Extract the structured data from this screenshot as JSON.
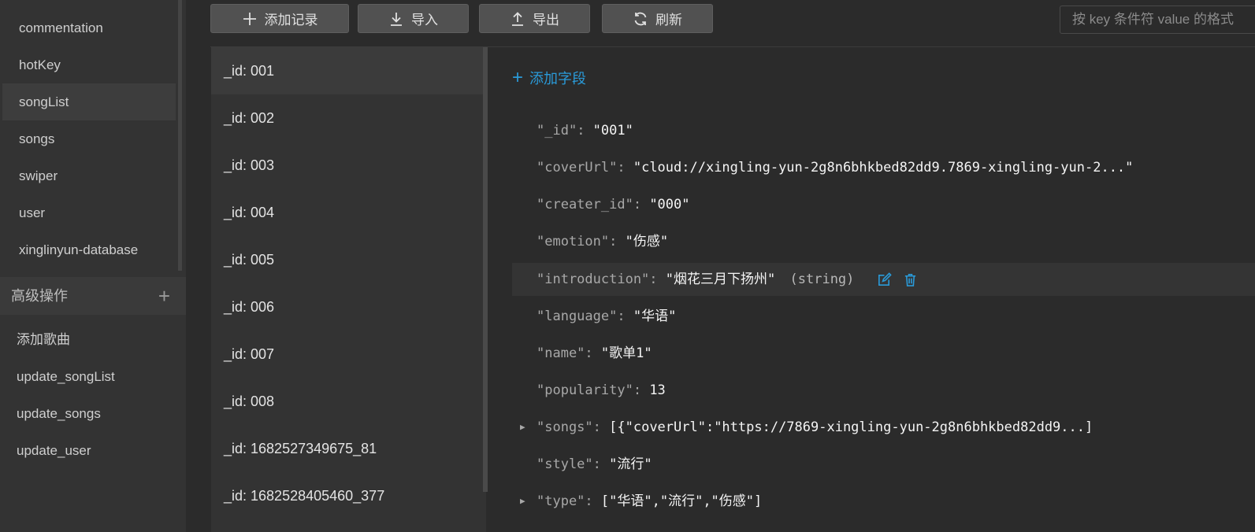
{
  "sidebar": {
    "collections": [
      {
        "label": "commentation"
      },
      {
        "label": "hotKey"
      },
      {
        "label": "songList",
        "active": true
      },
      {
        "label": "songs"
      },
      {
        "label": "swiper"
      },
      {
        "label": "user"
      },
      {
        "label": "xinglinyun-database"
      }
    ],
    "advanced_header": "高级操作",
    "advanced_items": [
      {
        "label": "添加歌曲"
      },
      {
        "label": "update_songList"
      },
      {
        "label": "update_songs"
      },
      {
        "label": "update_user"
      }
    ]
  },
  "toolbar": {
    "add_label": "添加记录",
    "import_label": "导入",
    "export_label": "导出",
    "refresh_label": "刷新",
    "search_placeholder": "按 key 条件符 value 的格式"
  },
  "records": [
    "_id: 001",
    "_id: 002",
    "_id: 003",
    "_id: 004",
    "_id: 005",
    "_id: 006",
    "_id: 007",
    "_id: 008",
    "_id: 1682527349675_81",
    "_id: 1682528405460_377"
  ],
  "detail": {
    "add_field_label": "添加字段",
    "fields": [
      {
        "key": "\"_id\"",
        "value": "\"001\""
      },
      {
        "key": "\"coverUrl\"",
        "value": "\"cloud://xingling-yun-2g8n6bhkbed82dd9.7869-xingling-yun-2...\""
      },
      {
        "key": "\"creater_id\"",
        "value": "\"000\""
      },
      {
        "key": "\"emotion\"",
        "value": "\"伤感\""
      },
      {
        "key": "\"introduction\"",
        "value": "\"烟花三月下扬州\"",
        "type": "(string)"
      },
      {
        "key": "\"language\"",
        "value": "\"华语\""
      },
      {
        "key": "\"name\"",
        "value": "\"歌单1\""
      },
      {
        "key": "\"popularity\"",
        "value": "13"
      },
      {
        "key": "\"songs\"",
        "value": "[{\"coverUrl\":\"https://7869-xingling-yun-2g8n6bhkbed82dd9...]"
      },
      {
        "key": "\"style\"",
        "value": "\"流行\""
      },
      {
        "key": "\"type\"",
        "value": "[\"华语\",\"流行\",\"伤感\"]"
      }
    ]
  },
  "colors": {
    "accent": "#2a9ad8",
    "background": "#2b2b2b",
    "sidebar": "#333333"
  }
}
